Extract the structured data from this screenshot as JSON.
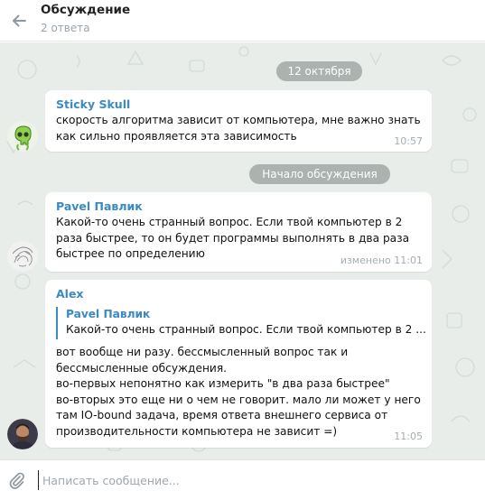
{
  "header": {
    "title": "Обсуждение",
    "subtitle": "2 ответа"
  },
  "chat": {
    "date_separator": "12 октября",
    "discussion_start": "Начало обсуждения",
    "messages": [
      {
        "sender": "Sticky Skull",
        "text": "скорость алгоритма зависит от компьютера, мне важно знать\nкак сильно проявляется эта зависимость",
        "time": "10:57",
        "avatar": "green-skull-sticker-avatar"
      },
      {
        "sender": "Pavel Павлик",
        "text": "Какой-то очень странный вопрос. Если твой компьютер в 2\nраза быстрее, то он будет программы выполнять в два раза\nбыстрее по определению",
        "time": "изменено 11:01",
        "avatar": "sketch-avatar"
      },
      {
        "sender": "Alex",
        "reply": {
          "name": "Pavel Павлик",
          "text": "Какой-то очень странный вопрос. Если твой компьютер в 2 ..."
        },
        "text": "вот вообще ни разу. бессмысленный вопрос так и\nбессмысленные обсуждения.\nво-первых непонятно как измерить \"в  два раза быстрее\"\nво-вторых это еще ни  о чем не говорит. мало ли может у него\nтам IO-bound задача, время ответа внешнего сервиса от\nпроизводительности компьютера не зависит =)",
        "time": "11:05",
        "avatar": "bearded-man-avatar"
      }
    ]
  },
  "composer": {
    "placeholder": "Написать сообщение..."
  },
  "colors": {
    "accent": "#3a8ac4",
    "chat_background": "#e8ede9",
    "pill": "#7f8a87"
  }
}
